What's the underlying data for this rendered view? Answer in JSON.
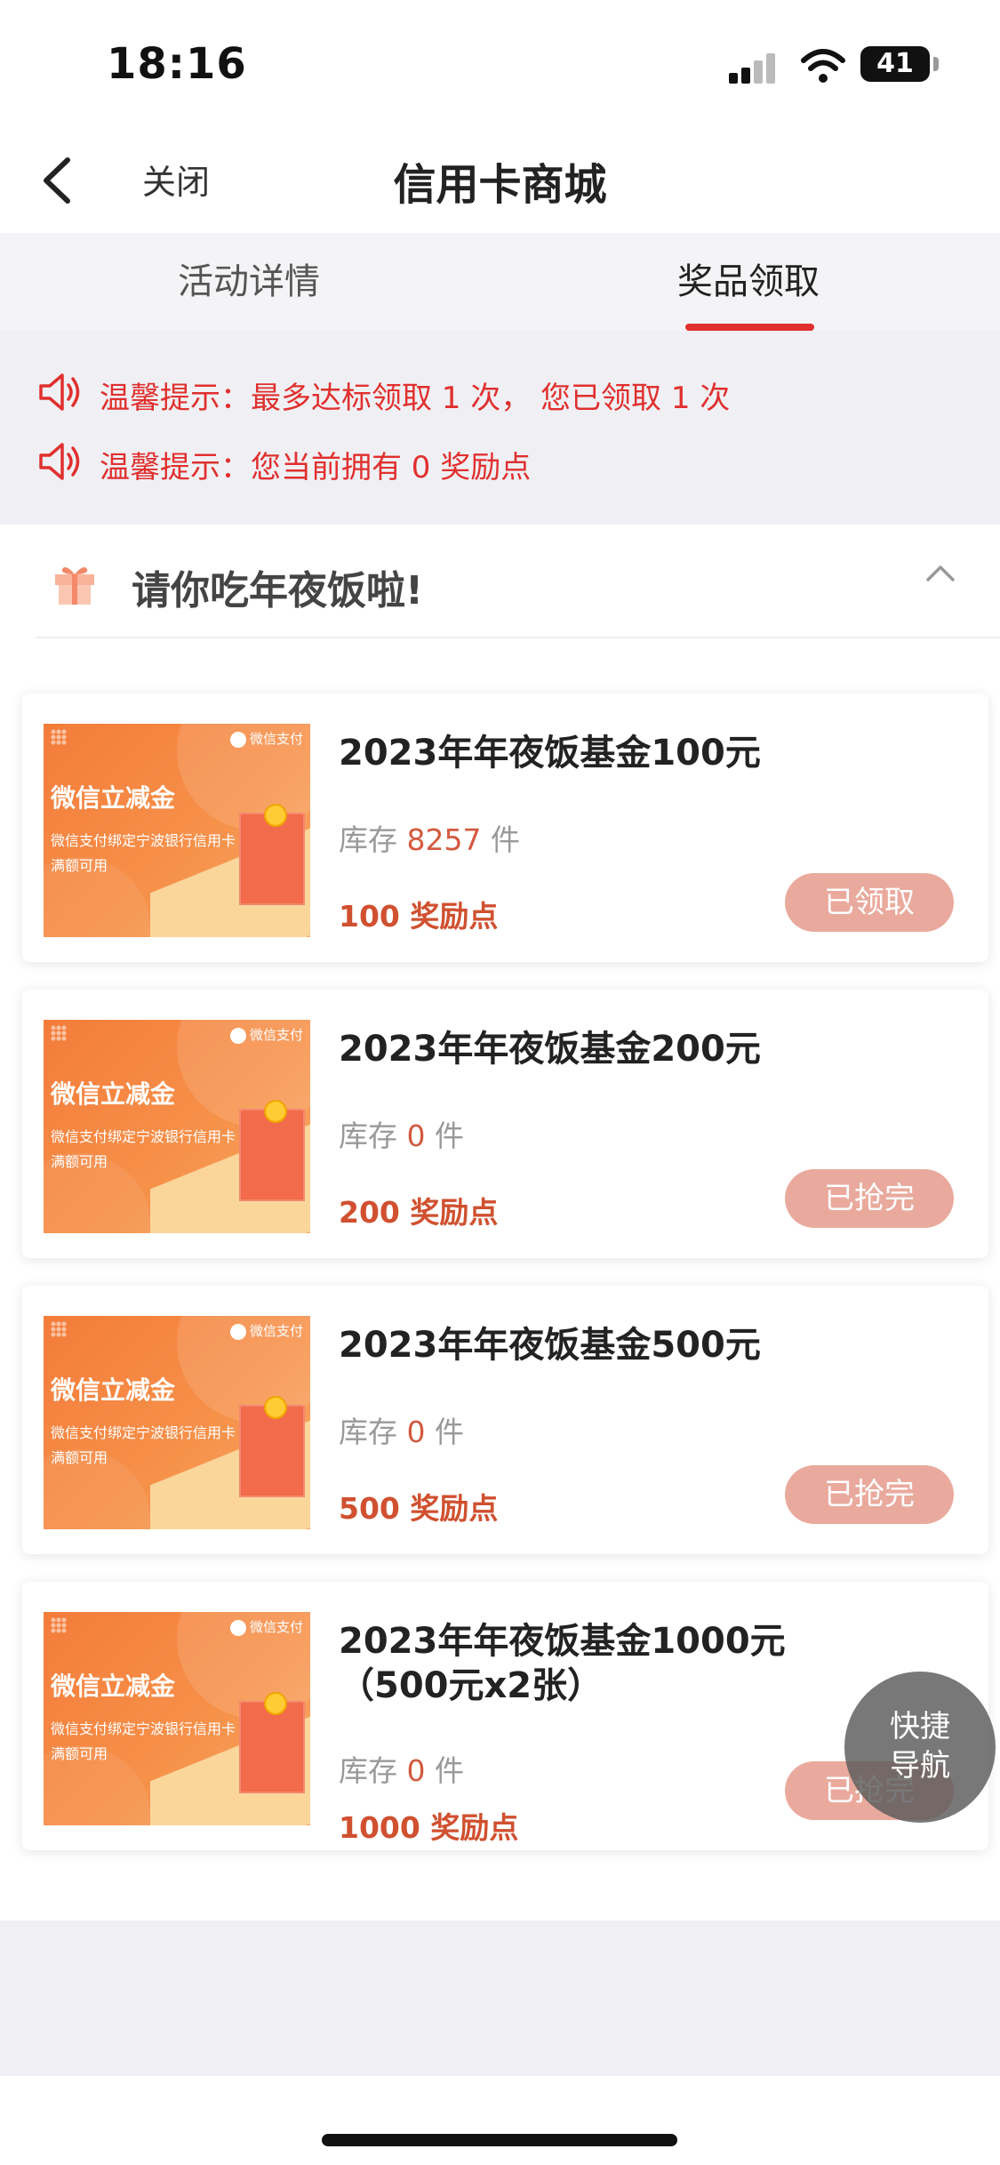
{
  "status_bar": {
    "time": "18:16",
    "battery": "41"
  },
  "nav": {
    "close_label": "关闭",
    "title": "信用卡商城"
  },
  "tabs": [
    {
      "label": "活动详情"
    },
    {
      "label": "奖品领取"
    }
  ],
  "notices": [
    {
      "text": "温馨提示：最多达标领取 1 次， 您已领取 1 次"
    },
    {
      "text": "温馨提示：您当前拥有 0 奖励点"
    }
  ],
  "section": {
    "title": "请你吃年夜饭啦!"
  },
  "thumb": {
    "pay_brand": "微信支付",
    "headline": "微信立减金",
    "line1": "微信支付绑定宁波银行信用卡",
    "line2": "满额可用"
  },
  "cards": [
    {
      "title": "2023年年夜饭基金100元",
      "stock_prefix": "库存",
      "stock": "8257",
      "stock_unit": "件",
      "points": "100 奖励点",
      "button": "已领取"
    },
    {
      "title": "2023年年夜饭基金200元",
      "stock_prefix": "库存",
      "stock": "0",
      "stock_unit": "件",
      "points": "200 奖励点",
      "button": "已抢完"
    },
    {
      "title": "2023年年夜饭基金500元",
      "stock_prefix": "库存",
      "stock": "0",
      "stock_unit": "件",
      "points": "500 奖励点",
      "button": "已抢完"
    },
    {
      "title_line1": "2023年年夜饭基金1000元",
      "title_line2": "（500元x2张）",
      "stock_prefix": "库存",
      "stock": "0",
      "stock_unit": "件",
      "points": "1000 奖励点",
      "button": "已抢完"
    }
  ],
  "quick_nav": {
    "line1": "快捷",
    "line2": "导航"
  },
  "colors": {
    "accent_red": "#e0302e",
    "points_red": "#d0502f",
    "button_bg": "#e9aa9d"
  }
}
